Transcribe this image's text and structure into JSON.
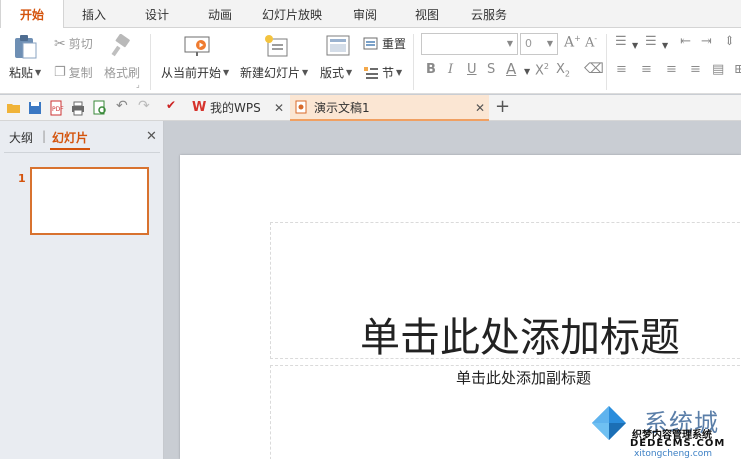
{
  "menu": {
    "tabs": [
      "开始",
      "插入",
      "设计",
      "动画",
      "幻灯片放映",
      "审阅",
      "视图",
      "云服务"
    ]
  },
  "ribbon": {
    "paste": "粘贴",
    "cut": "剪切",
    "copy": "复制",
    "format_painter": "格式刷",
    "from_current": "从当前开始",
    "new_slide": "新建幻灯片",
    "layout": "版式",
    "reset": "重置",
    "section": "节",
    "font_size": "0"
  },
  "quickbar": {
    "doc_tabs": [
      "我的WPS",
      "演示文稿1"
    ]
  },
  "left_pane": {
    "tab_outline": "大纲",
    "tab_slides": "幻灯片",
    "slide_number": "1"
  },
  "slide": {
    "title_placeholder": "单击此处添加标题",
    "subtitle_placeholder": "单击此处添加副标题"
  },
  "watermark": {
    "brand": "系统城",
    "line1": "织梦内容管理系统",
    "line2": "DEDECMS.COM",
    "line3": "xitongcheng.com"
  },
  "colors": {
    "accent": "#d4530c",
    "thumb_border": "#d8722f",
    "active_doc_tab": "#fbe6d3"
  }
}
